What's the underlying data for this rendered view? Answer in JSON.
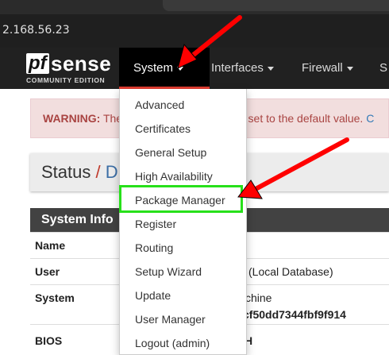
{
  "browser": {
    "address": "2.168.56.23"
  },
  "logo": {
    "pf": "pf",
    "sense": "sense",
    "edition": "COMMUNITY EDITION"
  },
  "nav": {
    "system": "System",
    "interfaces": "Interfaces",
    "firewall": "Firewall",
    "more": "S"
  },
  "warning": {
    "label": "WARNING:",
    "left_text": "The",
    "right_text": "d is set to the default value.",
    "link_text": "C"
  },
  "status": {
    "title": "Status",
    "separator": "/",
    "crumb": "D"
  },
  "panel": {
    "title": "System Info",
    "rows": [
      {
        "label": "Name",
        "value": ""
      },
      {
        "label": "User",
        "value": "(Local Database)"
      },
      {
        "label": "System",
        "value": "chine",
        "value2": "cf50dd7344fbf9f914"
      },
      {
        "label": "BIOS",
        "value": "H"
      }
    ]
  },
  "system_menu": {
    "items": [
      "Advanced",
      "Certificates",
      "General Setup",
      "High Availability",
      "Package Manager",
      "Register",
      "Routing",
      "Setup Wizard",
      "Update",
      "User Manager",
      "Logout (admin)"
    ],
    "highlighted": "Package Manager"
  },
  "colors": {
    "navbar": "#212121",
    "active_underline": "#e03c31",
    "warning_bg": "#f2dede",
    "highlight": "#27e01a",
    "arrow": "#ff0000"
  }
}
